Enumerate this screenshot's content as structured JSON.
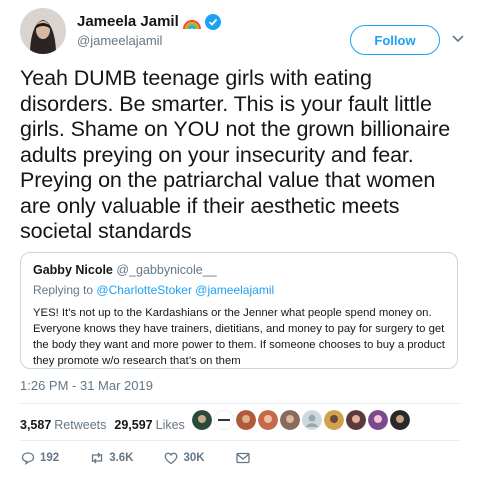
{
  "author": {
    "display_name": "Jameela Jamil",
    "handle": "@jameelajamil",
    "avatar_icon": "profile-avatar",
    "badge_icons": [
      "rainbow-icon",
      "verified-icon"
    ]
  },
  "follow_label": "Follow",
  "tweet": {
    "text": "Yeah DUMB teenage girls with eating disorders. Be smarter. This is your fault little girls. Shame on YOU not the grown billionaire adults preying on your insecurity and fear. Preying on the patriarchal value that women are only valuable if their aesthetic meets societal standards"
  },
  "quoted_tweet": {
    "display_name": "Gabby Nicole",
    "handle": "@_gabbynicole__",
    "replying_prefix": "Replying to",
    "replying_to": "@CharlotteStoker @jameelajamil",
    "text": "YES! It’s not up to the Kardashians or the Jenner what people spend money on. Everyone knows they have trainers, dietitians, and money to pay for surgery to get the body they want and more power to them. If someone chooses to buy a product they promote w/o research that’s on them"
  },
  "timestamp": "1:26 PM - 31 Mar 2019",
  "stats": {
    "retweets_count": "3,587",
    "retweets_label": "Retweets",
    "likes_count": "29,597",
    "likes_label": "Likes"
  },
  "actions": {
    "replies": "192",
    "retweets": "3.6K",
    "likes": "30K"
  },
  "colors": {
    "accent": "#1da1f2",
    "secondary_text": "#657786",
    "border": "#ccd6dd"
  }
}
